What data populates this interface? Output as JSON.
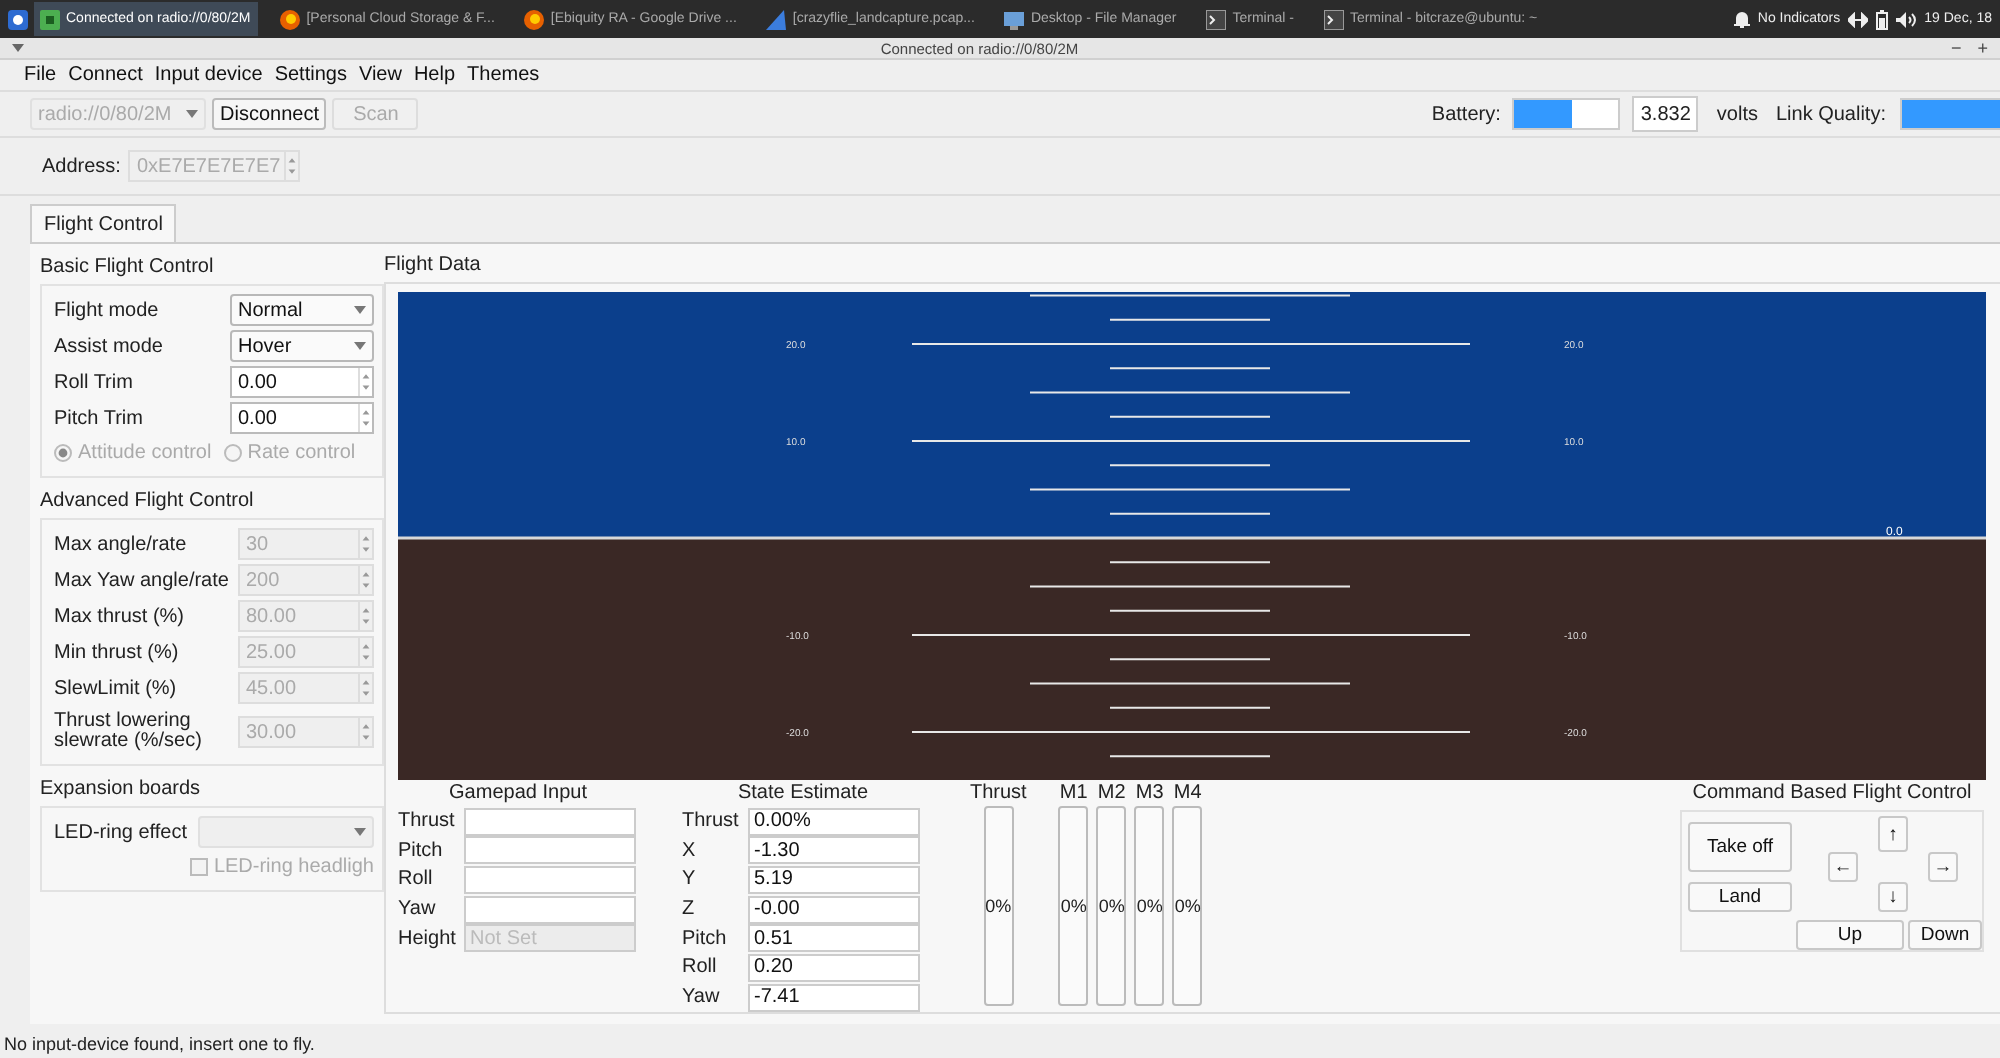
{
  "taskbar": {
    "tasks": [
      {
        "label": "Connected on radio://0/80/2M",
        "kind": "app",
        "selected": true
      },
      {
        "label": "[Personal Cloud Storage & F...",
        "kind": "browser",
        "selected": false
      },
      {
        "label": "[Ebiquity RA - Google Drive ...",
        "kind": "browser",
        "selected": false
      },
      {
        "label": "[crazyflie_landcapture.pcap...",
        "kind": "shark",
        "selected": false
      },
      {
        "label": "Desktop - File Manager",
        "kind": "folder",
        "selected": false
      },
      {
        "label": "Terminal -",
        "kind": "terminal",
        "selected": false
      },
      {
        "label": "Terminal - bitcraze@ubuntu: ~",
        "kind": "terminal",
        "selected": false
      }
    ],
    "indicators": "No Indicators",
    "clock": "19 Dec, 18"
  },
  "window": {
    "title": "Connected on radio://0/80/2M",
    "controls": [
      "−",
      "+"
    ]
  },
  "menu": [
    "File",
    "Connect",
    "Input device",
    "Settings",
    "View",
    "Help",
    "Themes"
  ],
  "toolbar": {
    "uri": {
      "value": "radio://0/80/2M",
      "disabled": true
    },
    "buttons": [
      {
        "label": "Disconnect",
        "disabled": false
      },
      {
        "label": "Scan",
        "disabled": true
      }
    ],
    "battery": {
      "label": "Battery:",
      "level": 0.55,
      "reading": "3.832",
      "unit": "volts"
    },
    "link": {
      "label": "Link Quality:",
      "level": 1
    }
  },
  "address": {
    "label": "Address:",
    "value": "0xE7E7E7E7E7",
    "disabled": true
  },
  "tabs": [
    {
      "label": "Flight Control",
      "selected": true
    }
  ],
  "basic": {
    "title": "Basic Flight Control",
    "rows": [
      {
        "label": "Flight mode",
        "kind": "combo",
        "value": "Normal",
        "disabled": false
      },
      {
        "label": "Assist mode",
        "kind": "combo",
        "value": "Hover",
        "disabled": false
      },
      {
        "label": "Roll Trim",
        "kind": "spin",
        "value": "0.00",
        "disabled": false
      },
      {
        "label": "Pitch Trim",
        "kind": "spin",
        "value": "0.00",
        "disabled": false
      }
    ],
    "radios": [
      {
        "label": "Attitude control",
        "selected": true,
        "disabled": true
      },
      {
        "label": "Rate control",
        "selected": false,
        "disabled": true
      }
    ]
  },
  "advanced": {
    "title": "Advanced Flight Control",
    "rows": [
      {
        "label": "Max angle/rate",
        "kind": "spin",
        "value": "30",
        "disabled": true
      },
      {
        "label": "Max Yaw angle/rate",
        "kind": "spin",
        "value": "200",
        "disabled": true
      },
      {
        "label": "Max thrust (%)",
        "kind": "spin",
        "value": "80.00",
        "disabled": true
      },
      {
        "label": "Min thrust (%)",
        "kind": "spin",
        "value": "25.00",
        "disabled": true
      },
      {
        "label": "SlewLimit (%)",
        "kind": "spin",
        "value": "45.00",
        "disabled": true
      },
      {
        "label": "Thrust lowering slewrate (%/sec)",
        "kind": "spin",
        "value": "30.00",
        "disabled": true
      }
    ]
  },
  "expansion": {
    "title": "Expansion boards",
    "rows": [
      {
        "label": "LED-ring effect",
        "kind": "combo",
        "disabled": true
      }
    ],
    "checkbox": {
      "label": "LED-ring headligh",
      "checked": false,
      "disabled": true
    }
  },
  "flight_data": {
    "title": "Flight Data",
    "ladder_left": [
      {
        "label": "20.0"
      },
      {
        "label": "10.0"
      },
      {
        "label": "-10.0"
      },
      {
        "label": "-20.0"
      }
    ],
    "ladder_right": [
      {
        "label": "20.0"
      },
      {
        "label": "10.0"
      },
      {
        "label": "-10.0"
      },
      {
        "label": "-20.0"
      }
    ],
    "zero_label": "0.0"
  },
  "gamepad": {
    "title": "Gamepad Input",
    "rows": [
      {
        "label": "Thrust",
        "disabled": false
      },
      {
        "label": "Pitch",
        "disabled": false
      },
      {
        "label": "Roll",
        "disabled": false
      },
      {
        "label": "Yaw",
        "disabled": false
      },
      {
        "label": "Height",
        "placeholder": "Not Set",
        "disabled": true
      }
    ]
  },
  "state": {
    "title": "State Estimate",
    "rows": [
      {
        "label": "Thrust",
        "value": "0.00%"
      },
      {
        "label": "X",
        "value": "-1.30"
      },
      {
        "label": "Y",
        "value": "5.19"
      },
      {
        "label": "Z",
        "value": "-0.00"
      },
      {
        "label": "Pitch",
        "value": "0.51"
      },
      {
        "label": "Roll",
        "value": "0.20"
      },
      {
        "label": "Yaw",
        "value": "-7.41"
      }
    ]
  },
  "motors": [
    {
      "label": "Thrust",
      "level": 0,
      "reading": "0%"
    },
    {
      "label": "M1",
      "level": 0,
      "reading": "0%"
    },
    {
      "label": "M2",
      "level": 0,
      "reading": "0%"
    },
    {
      "label": "M3",
      "level": 0,
      "reading": "0%"
    },
    {
      "label": "M4",
      "level": 0,
      "reading": "0%"
    }
  ],
  "command": {
    "title": "Command Based Flight Control",
    "buttons": [
      {
        "label": "Take off"
      },
      {
        "label": "Land"
      },
      {
        "label": "↑"
      },
      {
        "label": "←"
      },
      {
        "label": "→"
      },
      {
        "label": "↓"
      },
      {
        "label": "Up"
      },
      {
        "label": "Down"
      }
    ]
  },
  "status_bar": "No input-device found, insert one to fly."
}
